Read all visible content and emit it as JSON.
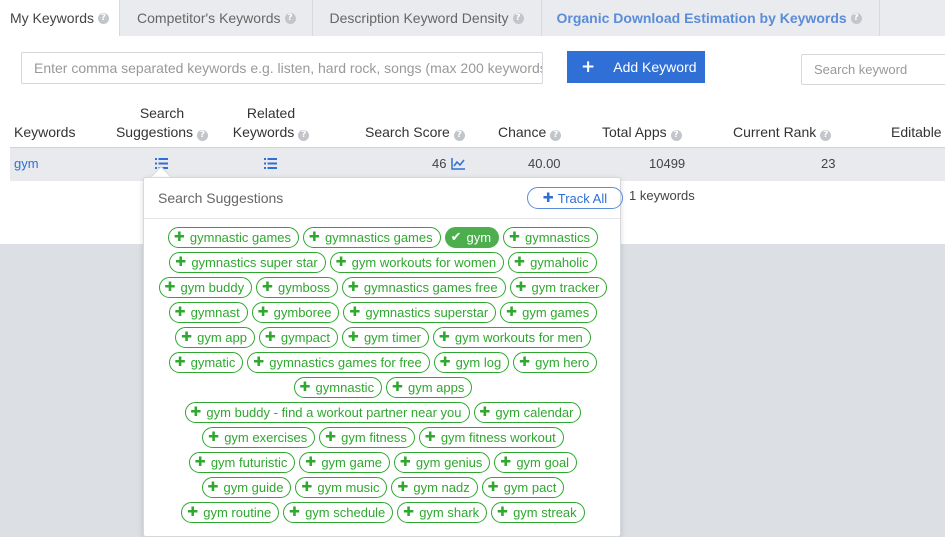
{
  "tabs": [
    {
      "label": "My Keywords"
    },
    {
      "label": "Competitor's Keywords"
    },
    {
      "label": "Description Keyword Density"
    },
    {
      "label": "Organic Download Estimation by Keywords"
    }
  ],
  "toolbar": {
    "keyword_input_placeholder": "Enter comma separated keywords e.g. listen, hard rock, songs (max 200 keywords",
    "add_button_label": "Add Keyword",
    "search_placeholder": "Search keyword"
  },
  "table": {
    "headers": {
      "keywords": "Keywords",
      "search_suggestions_1": "Search",
      "search_suggestions_2": "Suggestions",
      "related_1": "Related",
      "related_2": "Keywords",
      "search_score": "Search Score",
      "chance": "Chance",
      "total_apps": "Total Apps",
      "current_rank": "Current Rank",
      "editable": "Editable"
    },
    "row": {
      "keyword": "gym",
      "search_score": "46",
      "chance": "40.00",
      "total_apps": "10499",
      "current_rank": "23"
    },
    "count_text": "1 keywords"
  },
  "popup": {
    "title": "Search Suggestions",
    "track_all_label": "Track All",
    "selected": "gym",
    "suggestions": [
      "gymnastic games",
      "gymnastics games",
      "gym",
      "gymnastics",
      "gymnastics super star",
      "gym workouts for women",
      "gymaholic",
      "gym buddy",
      "gymboss",
      "gymnastics games free",
      "gym tracker",
      "gymnast",
      "gymboree",
      "gymnastics superstar",
      "gym games",
      "gym app",
      "gympact",
      "gym timer",
      "gym workouts for men",
      "gymatic",
      "gymnastics games for free",
      "gym log",
      "gym hero",
      "gymnastic",
      "gym apps",
      "gym buddy - find a workout partner near you",
      "gym calendar",
      "gym exercises",
      "gym fitness",
      "gym fitness workout",
      "gym futuristic",
      "gym game",
      "gym genius",
      "gym goal",
      "gym guide",
      "gym music",
      "gym nadz",
      "gym pact",
      "gym routine",
      "gym schedule",
      "gym shark",
      "gym streak"
    ]
  },
  "colors": {
    "accent_blue": "#2f6fd6",
    "chip_green": "#2ea82e",
    "selected_green": "#4cae4c"
  }
}
